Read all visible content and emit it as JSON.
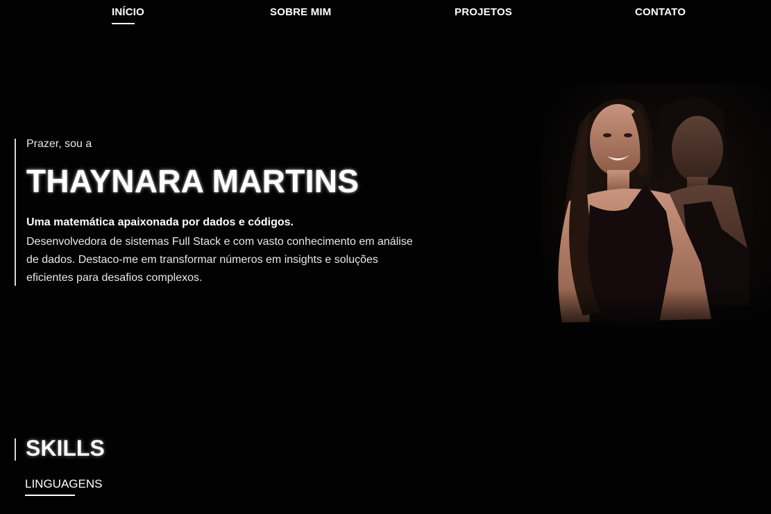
{
  "nav": {
    "items": [
      {
        "label": "INÍCIO",
        "active": true
      },
      {
        "label": "SOBRE MIM",
        "active": false
      },
      {
        "label": "PROJETOS",
        "active": false
      },
      {
        "label": "CONTATO",
        "active": false
      }
    ]
  },
  "hero": {
    "greeting": "Prazer, sou a",
    "name": "THAYNARA MARTINS",
    "tagline": "Uma matemática apaixonada por dados e códigos.",
    "description": "Desenvolvedora de sistemas Full Stack e com vasto conhecimento em análise de dados. Destaco-me em transformar números em insights e soluções eficientes para desafios complexos."
  },
  "skills": {
    "title": "SKILLS",
    "tabs": [
      {
        "label": "LINGUAGENS",
        "active": true
      }
    ]
  },
  "colors": {
    "background": "#020203",
    "text": "#ffffff",
    "accent_bar": "#d9d9d9"
  },
  "icons": {
    "portrait": "profile-photo"
  }
}
